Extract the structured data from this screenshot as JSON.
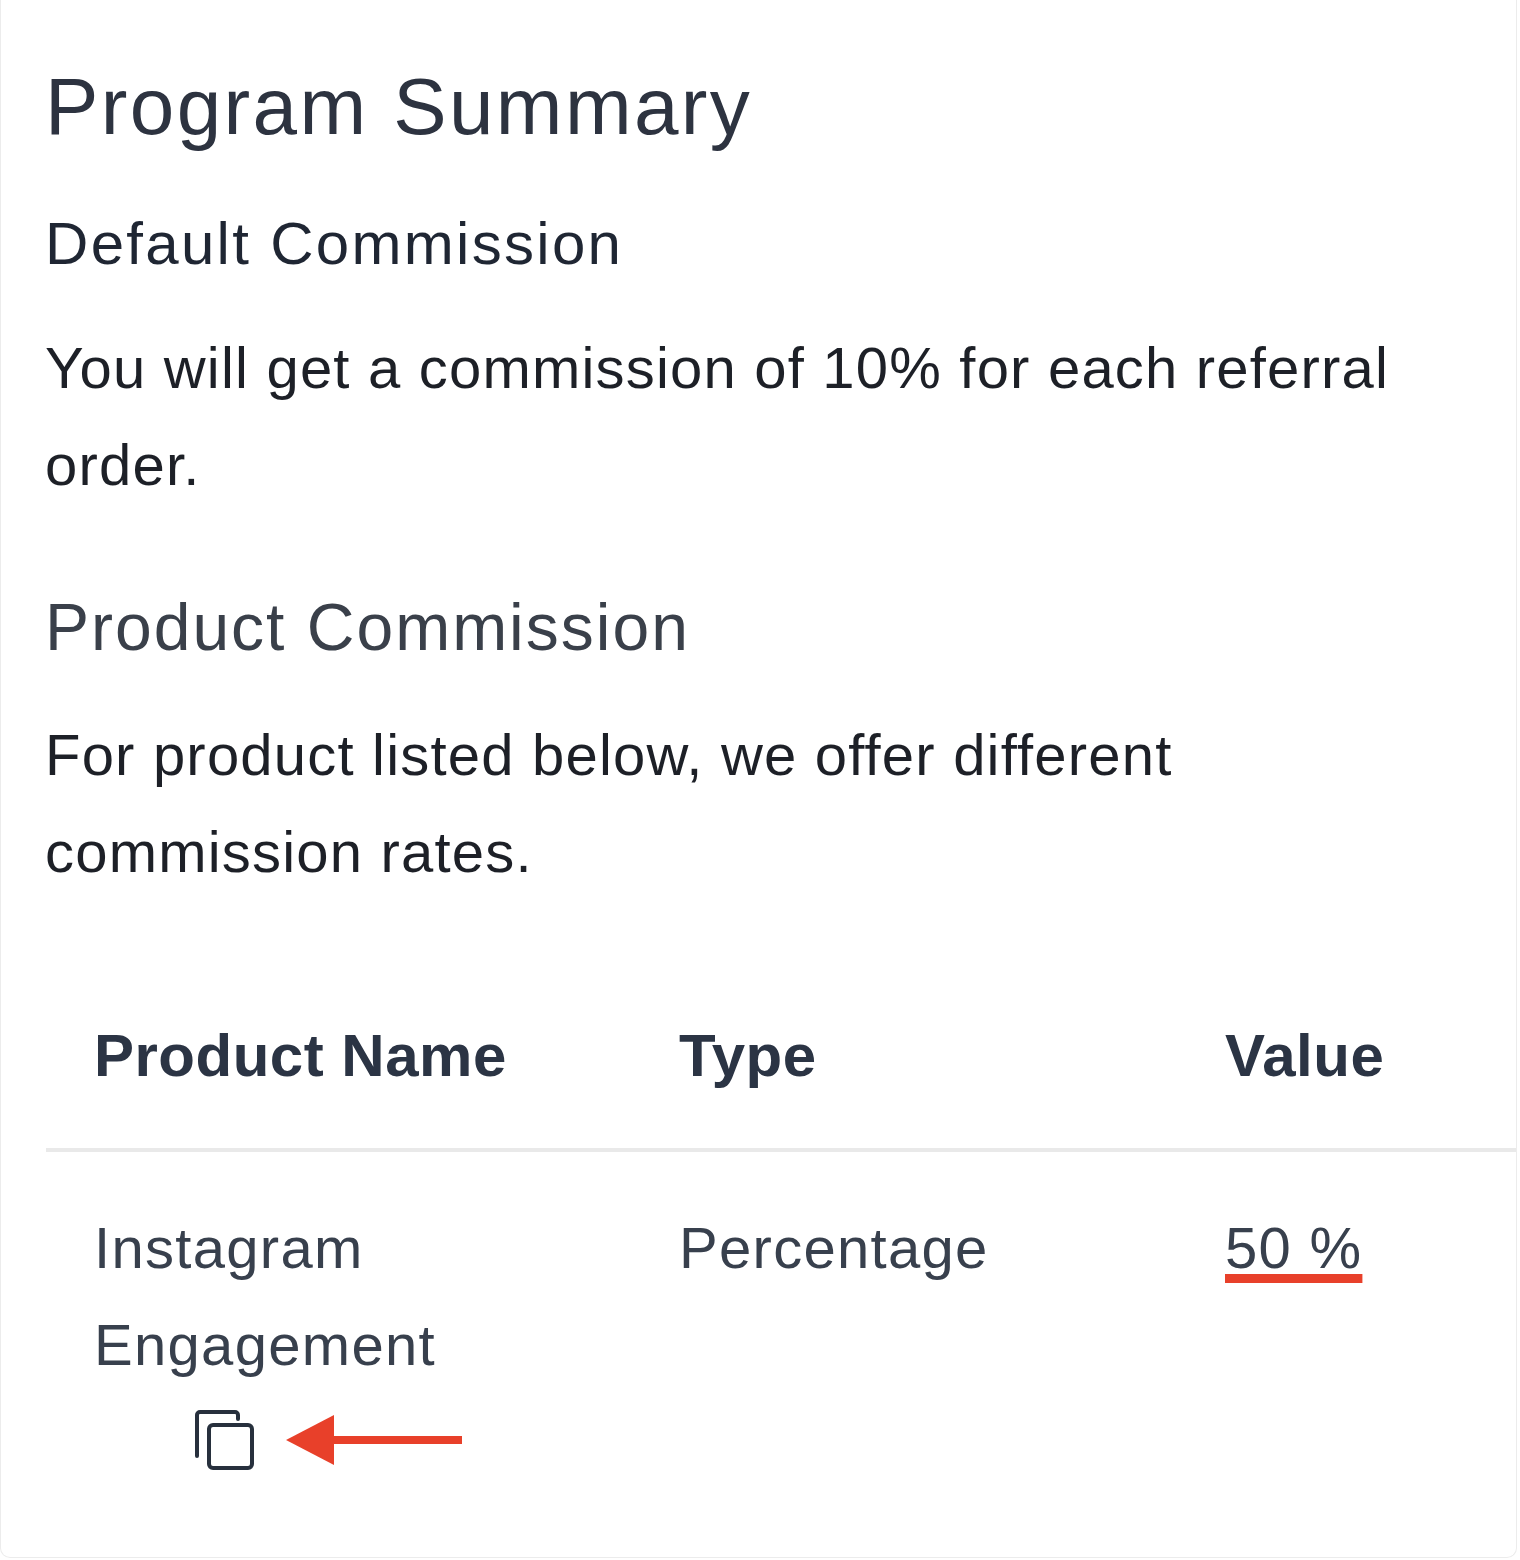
{
  "title": "Program Summary",
  "default_commission": {
    "heading": "Default Commission",
    "text": "You will get a commission of 10% for each referral order."
  },
  "product_commission": {
    "heading": "Product Commission",
    "text": "For product listed below, we offer different commission rates."
  },
  "table": {
    "columns": [
      "Product Name",
      "Type",
      "Value"
    ],
    "rows": [
      {
        "product_name": "Instagram Engagement",
        "type": "Percentage",
        "value": "50 %",
        "value_marked": true,
        "copy_arrow": true
      }
    ]
  }
}
